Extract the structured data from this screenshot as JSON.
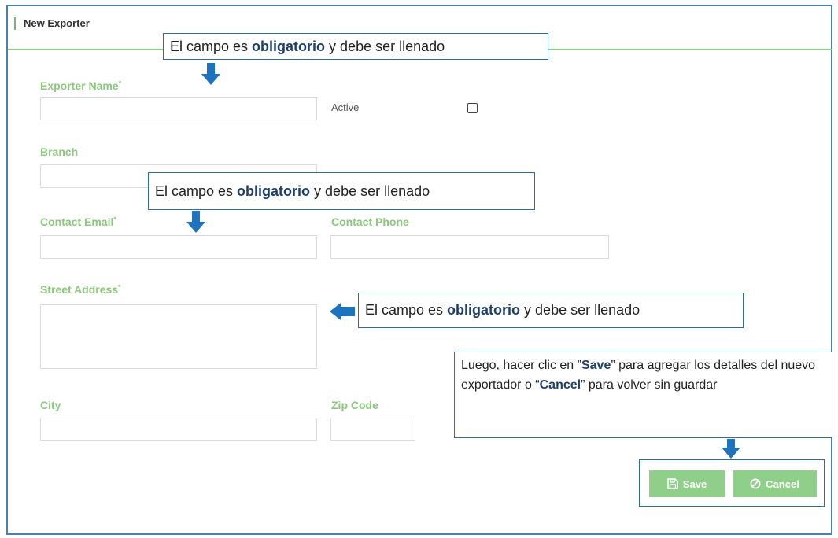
{
  "page": {
    "title": "New Exporter"
  },
  "form": {
    "exporter_name_label": "Exporter Name",
    "required_mark": "*",
    "active_label": "Active",
    "active_checked": false,
    "branch_label": "Branch",
    "contact_email_label": "Contact Email",
    "contact_phone_label": "Contact Phone",
    "street_address_label": "Street Address",
    "city_label": "City",
    "zip_code_label": "Zip Code",
    "values": {
      "exporter_name": "",
      "branch": "",
      "contact_email": "",
      "contact_phone": "",
      "street_address": "",
      "city": "",
      "zip_code": ""
    }
  },
  "buttons": {
    "save_label": "Save",
    "cancel_label": "Cancel"
  },
  "callouts": {
    "required_pre": "El campo es ",
    "required_bold": "obligatorio",
    "required_post": " y debe ser llenado",
    "action_1": "Luego, hacer clic en ”",
    "action_save": "Save",
    "action_2": "” para agregar los detalles del nuevo exportador o “",
    "action_cancel": "Cancel",
    "action_3": "” para volver sin guardar"
  },
  "colors": {
    "label_green": "#8bc77c",
    "button_green": "#8fcf8a",
    "callout_border": "#2e6da4",
    "arrow_blue": "#1e73be"
  },
  "icons": {
    "save": "floppy-disk-icon",
    "cancel": "ban-icon",
    "arrow": "arrow-icon"
  }
}
